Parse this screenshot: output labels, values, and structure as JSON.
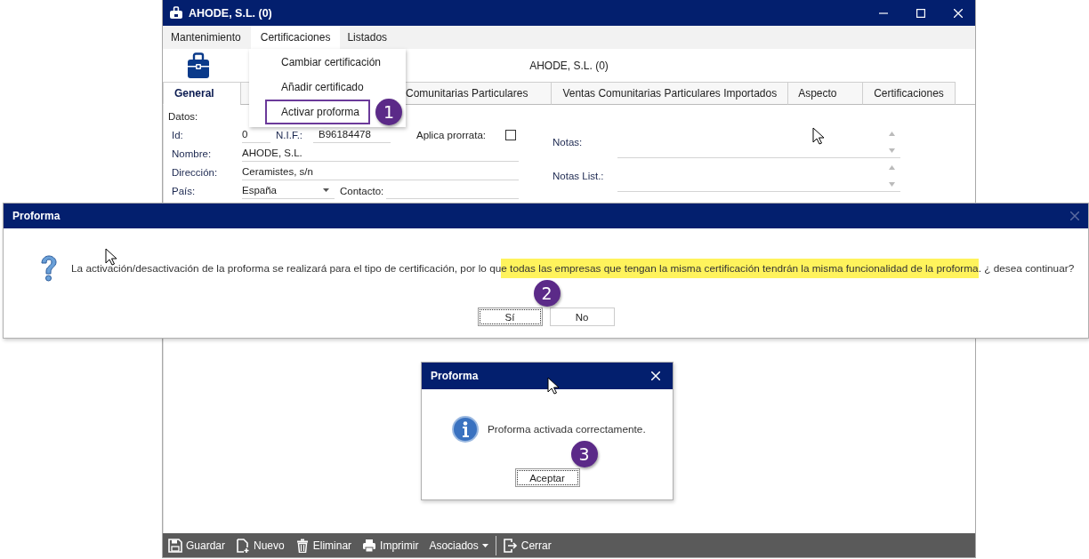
{
  "window": {
    "title": "AHODE, S.L. (0)"
  },
  "menu_bar": [
    {
      "label": "Mantenimiento",
      "selected": false
    },
    {
      "label": "Certificaciones",
      "selected": true
    },
    {
      "label": "Listados",
      "selected": false
    }
  ],
  "menu_dropdown": [
    {
      "label": "Cambiar certificación",
      "highlighted": false
    },
    {
      "label": "Añadir certificado",
      "highlighted": false
    },
    {
      "label": "Activar proforma",
      "highlighted": true,
      "callout": "1"
    }
  ],
  "header": {
    "title": "AHODE, S.L. (0)"
  },
  "tabs": [
    {
      "label": "General",
      "selected": true
    },
    {
      "label": "Comunitarias Particulares",
      "selected": false
    },
    {
      "label": "Ventas Comunitarias Particulares Importados",
      "selected": false
    },
    {
      "label": "Aspecto",
      "selected": false
    },
    {
      "label": "Certificaciones",
      "selected": false
    }
  ],
  "general": {
    "section": "Datos:",
    "id_label": "Id:",
    "id": "0",
    "nif_label": "N.I.F.:",
    "nif": "B96184478",
    "prorrata_label": "Aplica prorrata:",
    "prorrata_checked": false,
    "nombre_label": "Nombre:",
    "nombre": "AHODE, S.L.",
    "direccion_label": "Dirección:",
    "direccion": "Ceramistes, s/n",
    "pais_label": "País:",
    "pais": "España",
    "contacto_label": "Contacto:",
    "notas_label": "Notas:",
    "notas_list_label": "Notas List.:"
  },
  "toolbar": [
    {
      "label": "Guardar",
      "kind": "save",
      "separator_before": false
    },
    {
      "label": "Nuevo",
      "kind": "new",
      "separator_before": false
    },
    {
      "label": "Eliminar",
      "kind": "delete",
      "separator_before": false
    },
    {
      "label": "Imprimir",
      "kind": "print",
      "separator_before": false
    },
    {
      "label": "Asociados",
      "kind": "dropdown",
      "separator_before": false
    },
    {
      "label": "Cerrar",
      "kind": "exit",
      "separator_before": true
    }
  ],
  "confirm_dialog": {
    "title": "Proforma",
    "close_enabled": false,
    "kind": "question",
    "message": [
      {
        "text": "La activación/desactivación de la proforma se realizará para el tipo de certificación, por lo qu",
        "highlighted": false
      },
      {
        "text": "e todas las empresas que tengan la misma certificación tendrán la misma funcionalidad de la proforma",
        "highlighted": true
      },
      {
        "text": ". ¿ desea continuar?",
        "highlighted": false
      }
    ],
    "buttons": [
      {
        "label": "Sí",
        "focused": true,
        "callout": "2"
      },
      {
        "label": "No",
        "focused": false
      }
    ]
  },
  "info_dialog": {
    "title": "Proforma",
    "close_enabled": true,
    "kind": "info",
    "message": [
      {
        "text": "Proforma activada correctamente.",
        "highlighted": false
      }
    ],
    "buttons": [
      {
        "label": "Aceptar",
        "focused": true,
        "callout": "3"
      }
    ]
  }
}
